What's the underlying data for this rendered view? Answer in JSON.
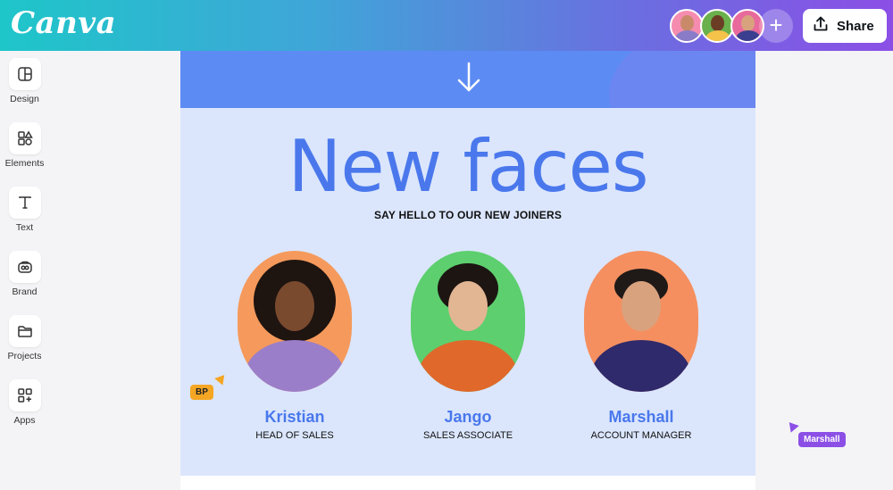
{
  "app": {
    "logo_text": "Canva"
  },
  "header": {
    "share_label": "Share",
    "add_collaborator": "+",
    "collaborators": [
      "collaborator-1",
      "collaborator-2",
      "collaborator-3"
    ]
  },
  "sidebar": {
    "items": [
      {
        "label": "Design",
        "icon": "design-icon"
      },
      {
        "label": "Elements",
        "icon": "elements-icon"
      },
      {
        "label": "Text",
        "icon": "text-icon"
      },
      {
        "label": "Brand",
        "icon": "brand-icon"
      },
      {
        "label": "Projects",
        "icon": "folder-icon"
      },
      {
        "label": "Apps",
        "icon": "apps-icon"
      }
    ]
  },
  "canvas": {
    "headline": "New faces",
    "subheadline": "SAY HELLO TO OUR NEW JOINERS",
    "people": [
      {
        "name": "Kristian",
        "role": "HEAD OF SALES",
        "bg": "#f59a5c"
      },
      {
        "name": "Jango",
        "role": "SALES ASSOCIATE",
        "bg": "#5dcf6e"
      },
      {
        "name": "Marshall",
        "role": "ACCOUNT MANAGER",
        "bg": "#f58f5f"
      }
    ]
  },
  "cursors": [
    {
      "label": "BP",
      "color": "#f5a623"
    },
    {
      "label": "Marshall",
      "color": "#8b4fe6"
    }
  ],
  "colors": {
    "accent": "#4a78ec",
    "brand_gradient_start": "#1ec6c9",
    "brand_gradient_end": "#8b4fe6"
  }
}
